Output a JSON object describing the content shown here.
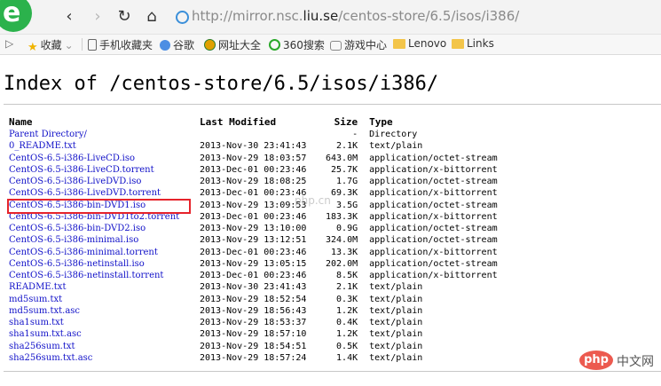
{
  "browser": {
    "logo_letter": "e",
    "nav": {
      "back": "‹",
      "forward": "›",
      "reload": "↻",
      "home": "⌂"
    },
    "url_prefix": "http://mirror.nsc.",
    "url_domain": "liu.se",
    "url_path": "/centos-store/6.5/isos/i386/"
  },
  "bookmarks": [
    {
      "icon": "star-icon",
      "label": "收藏"
    },
    {
      "icon": "phone-icon",
      "label": "手机收藏夹"
    },
    {
      "icon": "google-icon",
      "label": "谷歌"
    },
    {
      "icon": "globe-icon",
      "label": "网址大全"
    },
    {
      "icon": "360-icon",
      "label": "360搜索"
    },
    {
      "icon": "gamepad-icon",
      "label": "游戏中心"
    },
    {
      "icon": "folder-icon",
      "label": "Lenovo"
    },
    {
      "icon": "folder-icon",
      "label": "Links"
    }
  ],
  "page": {
    "title": "Index of /centos-store/6.5/isos/i386/",
    "columns": {
      "name": "Name",
      "modified": "Last Modified",
      "size": "Size",
      "type": "Type"
    },
    "rows": [
      {
        "name": "Parent Directory/",
        "modified": "",
        "size": "-",
        "type": "Directory"
      },
      {
        "name": "0_README.txt",
        "modified": "2013-Nov-30 23:41:43",
        "size": "2.1K",
        "type": "text/plain"
      },
      {
        "name": "CentOS-6.5-i386-LiveCD.iso",
        "modified": "2013-Nov-29 18:03:57",
        "size": "643.0M",
        "type": "application/octet-stream"
      },
      {
        "name": "CentOS-6.5-i386-LiveCD.torrent",
        "modified": "2013-Dec-01 00:23:46",
        "size": "25.7K",
        "type": "application/x-bittorrent"
      },
      {
        "name": "CentOS-6.5-i386-LiveDVD.iso",
        "modified": "2013-Nov-29 18:08:25",
        "size": "1.7G",
        "type": "application/octet-stream"
      },
      {
        "name": "CentOS-6.5-i386-LiveDVD.torrent",
        "modified": "2013-Dec-01 00:23:46",
        "size": "69.3K",
        "type": "application/x-bittorrent"
      },
      {
        "name": "CentOS-6.5-i386-bin-DVD1.iso",
        "modified": "2013-Nov-29 13:09:53",
        "size": "3.5G",
        "type": "application/octet-stream"
      },
      {
        "name": "CentOS-6.5-i386-bin-DVD1to2.torrent",
        "modified": "2013-Dec-01 00:23:46",
        "size": "183.3K",
        "type": "application/x-bittorrent"
      },
      {
        "name": "CentOS-6.5-i386-bin-DVD2.iso",
        "modified": "2013-Nov-29 13:10:00",
        "size": "0.9G",
        "type": "application/octet-stream"
      },
      {
        "name": "CentOS-6.5-i386-minimal.iso",
        "modified": "2013-Nov-29 13:12:51",
        "size": "324.0M",
        "type": "application/octet-stream"
      },
      {
        "name": "CentOS-6.5-i386-minimal.torrent",
        "modified": "2013-Dec-01 00:23:46",
        "size": "13.3K",
        "type": "application/x-bittorrent"
      },
      {
        "name": "CentOS-6.5-i386-netinstall.iso",
        "modified": "2013-Nov-29 13:05:15",
        "size": "202.0M",
        "type": "application/octet-stream"
      },
      {
        "name": "CentOS-6.5-i386-netinstall.torrent",
        "modified": "2013-Dec-01 00:23:46",
        "size": "8.5K",
        "type": "application/x-bittorrent"
      },
      {
        "name": "README.txt",
        "modified": "2013-Nov-30 23:41:43",
        "size": "2.1K",
        "type": "text/plain"
      },
      {
        "name": "md5sum.txt",
        "modified": "2013-Nov-29 18:52:54",
        "size": "0.3K",
        "type": "text/plain"
      },
      {
        "name": "md5sum.txt.asc",
        "modified": "2013-Nov-29 18:56:43",
        "size": "1.2K",
        "type": "text/plain"
      },
      {
        "name": "sha1sum.txt",
        "modified": "2013-Nov-29 18:53:37",
        "size": "0.4K",
        "type": "text/plain"
      },
      {
        "name": "sha1sum.txt.asc",
        "modified": "2013-Nov-29 18:57:10",
        "size": "1.2K",
        "type": "text/plain"
      },
      {
        "name": "sha256sum.txt",
        "modified": "2013-Nov-29 18:54:51",
        "size": "0.5K",
        "type": "text/plain"
      },
      {
        "name": "sha256sum.txt.asc",
        "modified": "2013-Nov-29 18:57:24",
        "size": "1.4K",
        "type": "text/plain"
      }
    ],
    "highlighted_row": 6
  },
  "watermark": {
    "text": "php.cn",
    "logo": "php",
    "site_text": "中文网"
  },
  "colors": {
    "link": "#1010c8",
    "highlight": "#e6232b",
    "logo_green": "#2bb24c"
  }
}
